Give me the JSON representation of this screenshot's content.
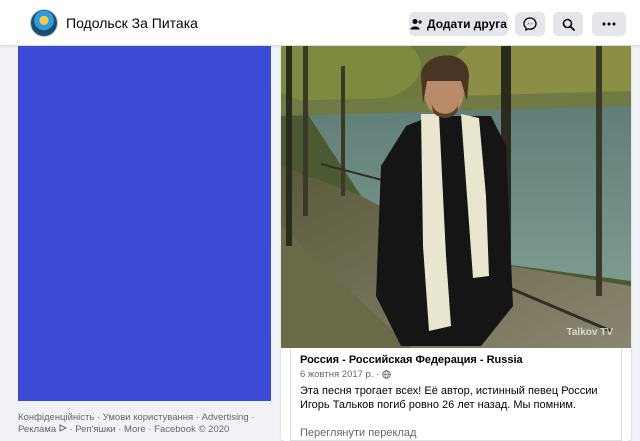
{
  "header": {
    "page_name": "Подольск За Питака",
    "add_friend_label": "Додати друга",
    "icons": [
      "messenger-icon",
      "search-icon",
      "more-icon",
      "add-friend-icon"
    ]
  },
  "footer": {
    "links": [
      "Конфіденційність",
      "Умови користування",
      "Advertising",
      "Реклама",
      "Реп'яшки",
      "More",
      "Facebook © 2020"
    ]
  },
  "post": {
    "watermark": "Talkov TV",
    "shared": {
      "title": "Россия - Российская Федерация - Russia",
      "date": "6 жовтня 2017 р. ·",
      "text_line1": "Эта песня трогает всех! Её автор, истинный певец России",
      "text_line2": "Игорь Тальков погиб ровно 26 лет назад. Мы помним.",
      "translate_label": "Переглянути переклад"
    }
  },
  "colors": {
    "accent_blue": "#3b4bd6",
    "background": "#f0f2f5",
    "button_gray": "#e4e6eb",
    "secondary_text": "#65676b"
  }
}
